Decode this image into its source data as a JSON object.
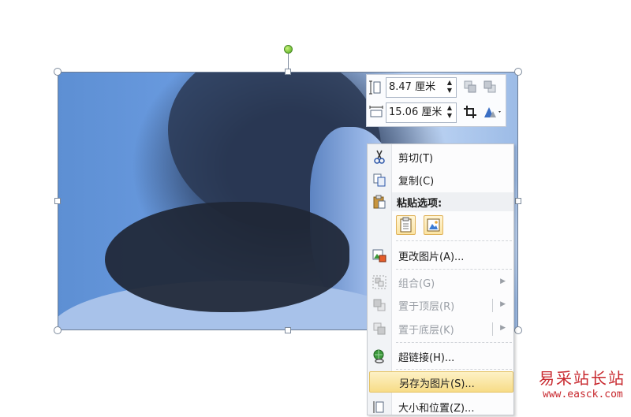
{
  "size_toolbar": {
    "height_value": "8.47 厘米",
    "width_value": "15.06 厘米",
    "height_icon": "shape-height-icon",
    "width_icon": "shape-width-icon",
    "spinner_up": "▲",
    "spinner_down": "▼"
  },
  "context_menu": {
    "items": [
      {
        "label": "剪切(T)",
        "icon": "scissors-icon"
      },
      {
        "label": "复制(C)",
        "icon": "copy-icon"
      },
      {
        "label": "粘贴选项:",
        "icon": "clipboard-icon"
      },
      {
        "label": "更改图片(A)...",
        "icon": "change-picture-icon"
      },
      {
        "label": "组合(G)",
        "icon": "group-icon",
        "disabled": true
      },
      {
        "label": "置于顶层(R)",
        "icon": "bring-to-front-icon",
        "disabled": true
      },
      {
        "label": "置于底层(K)",
        "icon": "send-to-back-icon",
        "disabled": true
      },
      {
        "label": "超链接(H)...",
        "icon": "hyperlink-icon"
      },
      {
        "label": "另存为图片(S)...",
        "icon": "",
        "highlighted": true
      },
      {
        "label": "大小和位置(Z)...",
        "icon": "size-position-icon"
      }
    ],
    "submenu_arrow": "▶"
  },
  "watermark": {
    "chinese": "易采站长站",
    "url": "www.easck.com"
  },
  "colors": {
    "highlight_bg": "#f7dc87",
    "watermark": "#c8282e",
    "rotation_handle": "#4fa81c"
  }
}
